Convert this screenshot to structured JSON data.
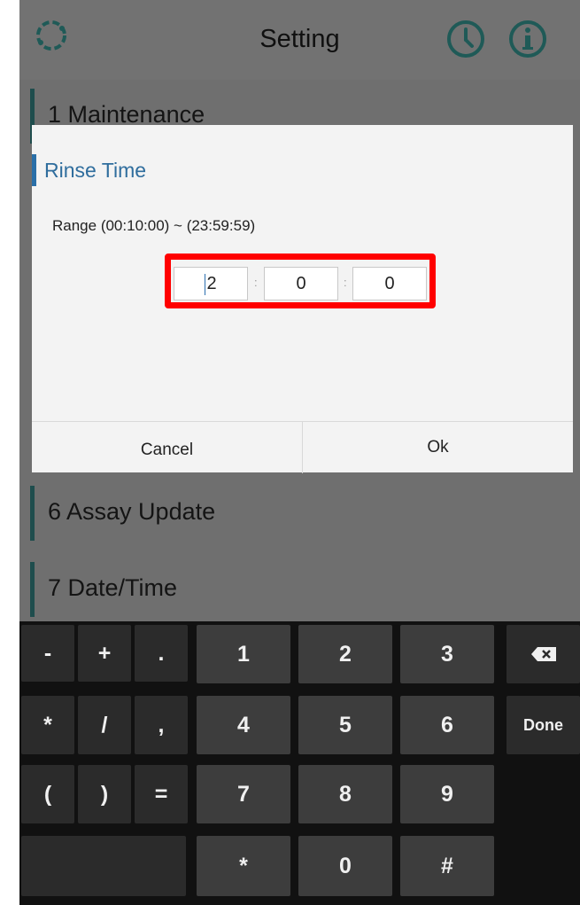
{
  "header": {
    "title": "Setting",
    "accent": "#1f5a57"
  },
  "list": [
    {
      "label": "1  Maintenance"
    },
    {
      "label": "6  Assay Update"
    },
    {
      "label": "7  Date/Time"
    }
  ],
  "dialog": {
    "title": "Rinse Time",
    "range": "Range (00:10:00) ~ (23:59:59)",
    "hours": "2",
    "minutes": "0",
    "seconds": "0",
    "separator": ":",
    "cancel": "Cancel",
    "ok": "Ok"
  },
  "keyboard": {
    "row1": [
      "-",
      "+",
      ".",
      "1",
      "2",
      "3"
    ],
    "row2": [
      "*",
      "/",
      ",",
      "4",
      "5",
      "6"
    ],
    "row3": [
      "(",
      ")",
      "=",
      "7",
      "8",
      "9"
    ],
    "row4": [
      "*",
      "0",
      "#"
    ],
    "backspace_icon": "backspace-icon",
    "done": "Done"
  }
}
